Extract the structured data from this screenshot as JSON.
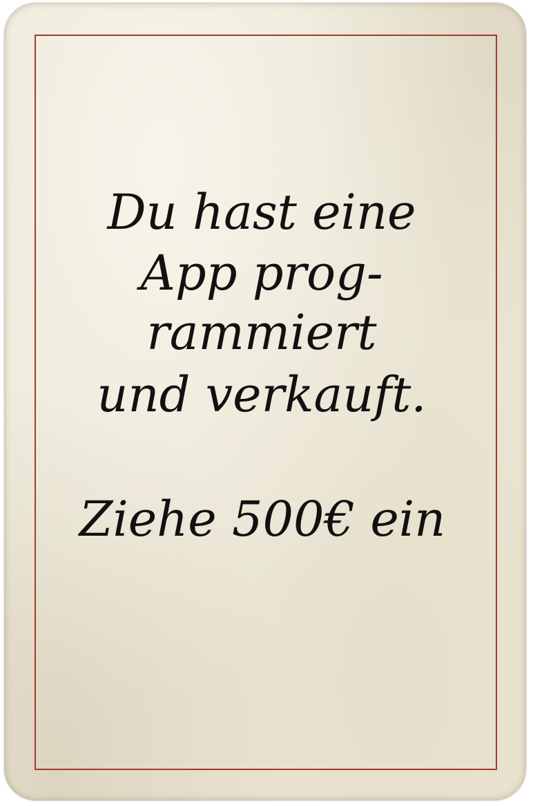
{
  "card": {
    "lines": [
      "Du hast eine",
      "App prog-",
      "rammiert",
      "und verkauft."
    ],
    "action": "Ziehe 500€ ein"
  },
  "colors": {
    "paper": "#ece7d6",
    "frame_line": "#a33a2e",
    "ink": "#111111"
  }
}
